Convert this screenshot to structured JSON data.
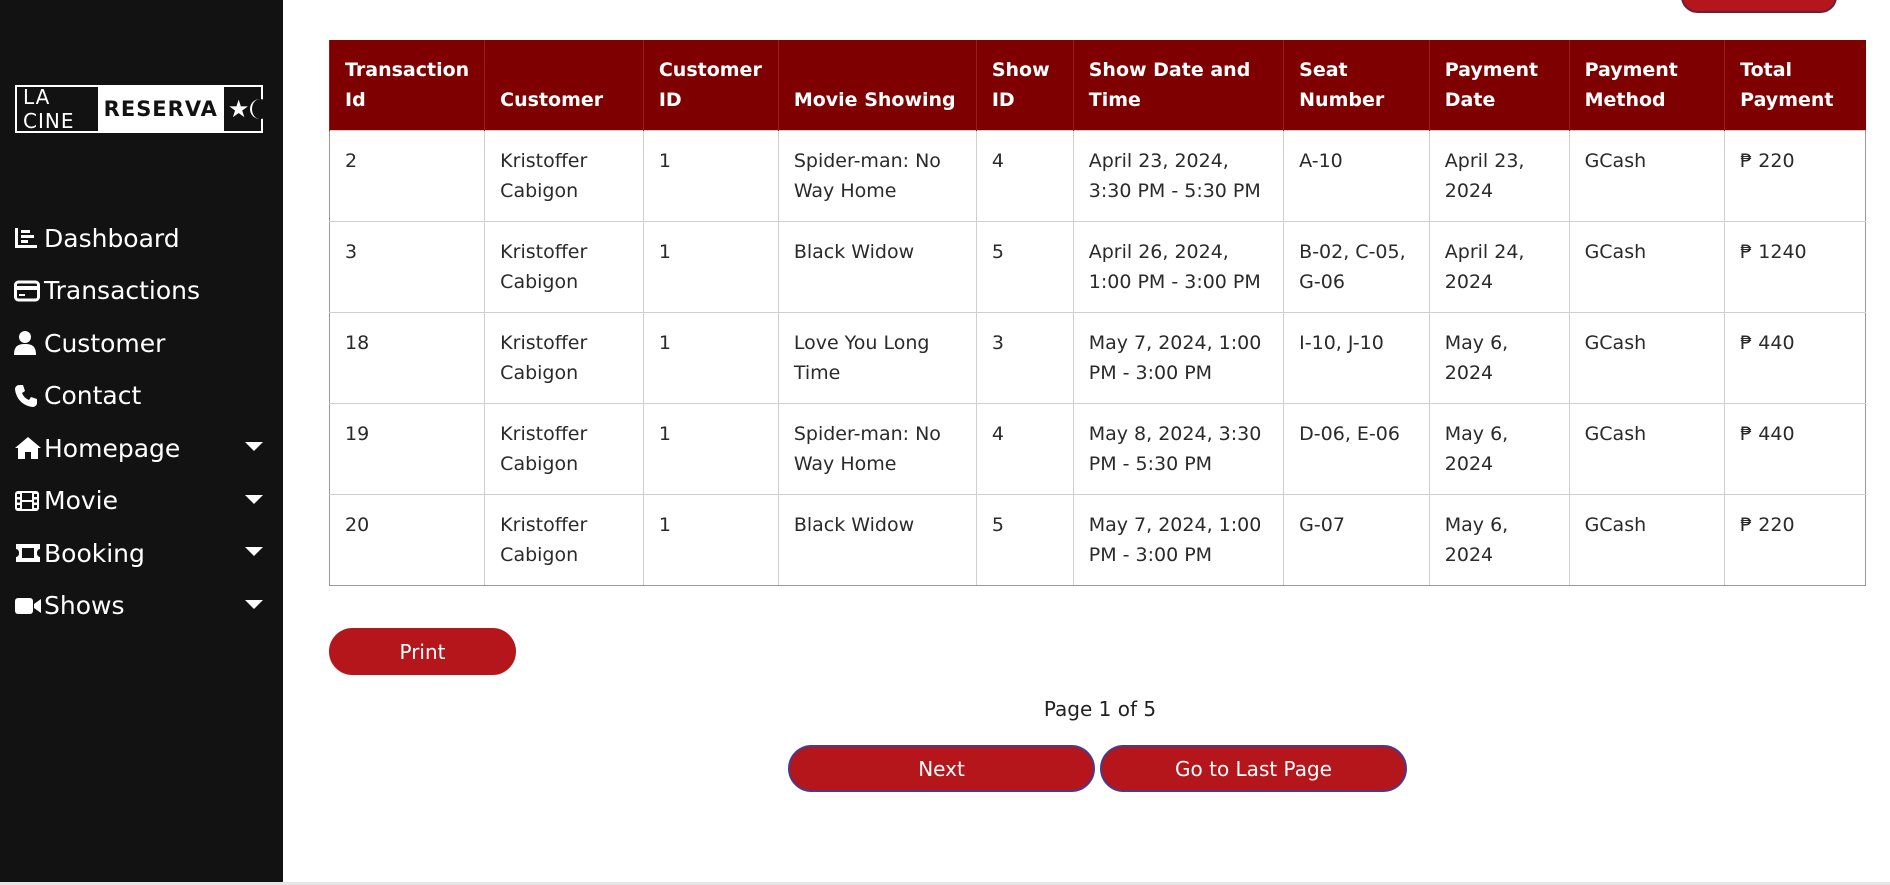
{
  "brand": {
    "part1": "LA CINE",
    "part2": "RESERVA",
    "star": "★"
  },
  "sidebar": {
    "items": [
      {
        "label": "Dashboard",
        "icon": "chart-list-icon",
        "dropdown": false
      },
      {
        "label": "Transactions",
        "icon": "credit-card-icon",
        "dropdown": false
      },
      {
        "label": "Customer",
        "icon": "user-icon",
        "dropdown": false
      },
      {
        "label": "Contact",
        "icon": "phone-icon",
        "dropdown": false
      },
      {
        "label": "Homepage",
        "icon": "home-icon",
        "dropdown": true
      },
      {
        "label": " Movie",
        "icon": "film-icon",
        "dropdown": true
      },
      {
        "label": "Booking",
        "icon": "ticket-icon",
        "dropdown": true
      },
      {
        "label": "Shows",
        "icon": "video-camera-icon",
        "dropdown": true
      }
    ]
  },
  "table": {
    "headers": [
      "Transaction Id",
      "Customer",
      "Customer ID",
      "Movie Showing",
      "Show ID",
      "Show Date and Time",
      "Seat Number",
      "Payment Date",
      "Payment Method",
      "Total Payment"
    ],
    "rows": [
      [
        "2",
        "Kristoffer Cabigon",
        "1",
        "Spider-man: No Way Home",
        "4",
        "April 23, 2024, 3:30 PM - 5:30 PM",
        "A-10",
        "April 23, 2024",
        "GCash",
        "₱ 220"
      ],
      [
        "3",
        "Kristoffer Cabigon",
        "1",
        "Black Widow",
        "5",
        "April 26, 2024, 1:00 PM - 3:00 PM",
        "B-02, C-05, G-06",
        "April 24, 2024",
        "GCash",
        "₱ 1240"
      ],
      [
        "18",
        "Kristoffer Cabigon",
        "1",
        "Love You Long Time",
        "3",
        "May 7, 2024, 1:00 PM - 3:00 PM",
        "I-10, J-10",
        "May 6, 2024",
        "GCash",
        "₱ 440"
      ],
      [
        "19",
        "Kristoffer Cabigon",
        "1",
        "Spider-man: No Way Home",
        "4",
        "May 8, 2024, 3:30 PM - 5:30 PM",
        "D-06, E-06",
        "May 6, 2024",
        "GCash",
        "₱ 440"
      ],
      [
        "20",
        "Kristoffer Cabigon",
        "1",
        "Black Widow",
        "5",
        "May 7, 2024, 1:00 PM - 3:00 PM",
        "G-07",
        "May 6, 2024",
        "GCash",
        "₱ 220"
      ]
    ]
  },
  "actions": {
    "print_label": "Print",
    "next_label": "Next",
    "last_label": "Go to Last Page"
  },
  "pagination": {
    "text": "Page 1 of 5"
  },
  "colors": {
    "sidebar_bg": "#121212",
    "header_bg": "#7f0000",
    "button_bg": "#b5161b"
  }
}
